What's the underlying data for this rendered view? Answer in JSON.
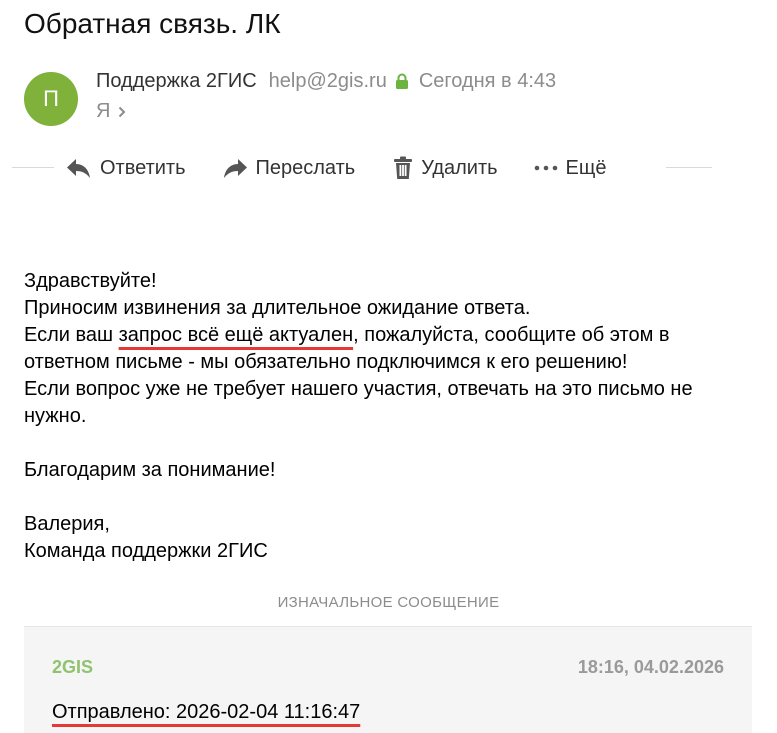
{
  "email": {
    "subject": "Обратная связь. ЛК",
    "sender": {
      "avatar_letter": "П",
      "name": "Поддержка 2ГИС",
      "email": "help@2gis.ru",
      "date": "Сегодня в 4:43",
      "recipient": "Я"
    },
    "toolbar": {
      "reply": "Ответить",
      "forward": "Переслать",
      "delete": "Удалить",
      "more": "Ещё"
    },
    "body": {
      "greeting": "Здравствуйте!",
      "apology": "Приносим извинения за длительное ожидание ответа.",
      "line3_pre": "Если ваш ",
      "line3_highlight": "запрос всё ещё актуален",
      "line3_post": ", пожалуйста, сообщите об этом в ответном письме - мы обязательно подключимся к его решению!",
      "line4": "Если вопрос уже не требует нашего участия, отвечать на это письмо не нужно.",
      "thanks": "Благодарим за понимание!",
      "signature_name": "Валерия,",
      "signature_team": "Команда поддержки 2ГИС"
    },
    "original_label": "ИЗНАЧАЛЬНОЕ СООБЩЕНИЕ",
    "quoted": {
      "from": "2GIS",
      "datetime": "18:16, 04.02.2026",
      "sent_line": "Отправлено: 2026-02-04 11:16:47"
    }
  },
  "colors": {
    "avatar": "#7fb13b",
    "lock": "#6cb33f",
    "highlight_underline": "#e53935",
    "quoted_from": "#8fc36e"
  },
  "icons": [
    "lock-icon",
    "chevron-right-icon",
    "reply-icon",
    "forward-icon",
    "trash-icon",
    "more-dots-icon"
  ]
}
